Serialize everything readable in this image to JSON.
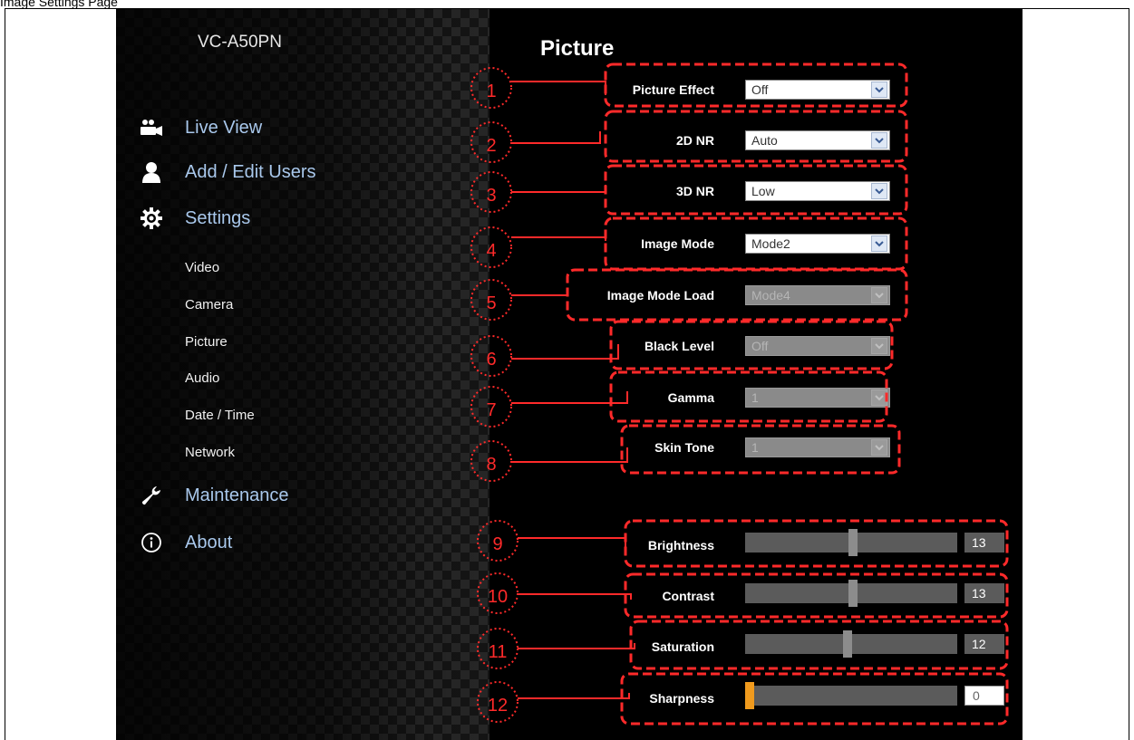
{
  "document_caption": "Image Settings Page",
  "device": {
    "name": "VC-A50PN"
  },
  "nav": {
    "items": [
      {
        "label": "Live View",
        "icon": "camera-users-icon"
      },
      {
        "label": "Add / Edit Users",
        "icon": "user-icon"
      },
      {
        "label": "Settings",
        "icon": "gear-icon"
      },
      {
        "label": "Maintenance",
        "icon": "wrench-icon"
      },
      {
        "label": "About",
        "icon": "info-icon"
      }
    ],
    "settings_subitems": [
      "Video",
      "Camera",
      "Picture",
      "Audio",
      "Date / Time",
      "Network"
    ]
  },
  "page": {
    "title": "Picture",
    "selects": [
      {
        "label": "Picture Effect",
        "value": "Off",
        "disabled": false
      },
      {
        "label": "2D NR",
        "value": "Auto",
        "disabled": false
      },
      {
        "label": "3D NR",
        "value": "Low",
        "disabled": false
      },
      {
        "label": "Image Mode",
        "value": "Mode2",
        "disabled": false
      },
      {
        "label": "Image Mode Load",
        "value": "Mode4",
        "disabled": true
      },
      {
        "label": "Black Level",
        "value": "Off",
        "disabled": true
      },
      {
        "label": "Gamma",
        "value": "1",
        "disabled": true
      },
      {
        "label": "Skin Tone",
        "value": "1",
        "disabled": true
      }
    ],
    "sliders": [
      {
        "label": "Brightness",
        "value": "13",
        "fraction": 0.51
      },
      {
        "label": "Contrast",
        "value": "13",
        "fraction": 0.51
      },
      {
        "label": "Saturation",
        "value": "12",
        "fraction": 0.48
      },
      {
        "label": "Sharpness",
        "value": "0",
        "fraction": 0.0
      }
    ]
  },
  "annotations": [
    "1",
    "2",
    "3",
    "4",
    "5",
    "6",
    "7",
    "8",
    "9",
    "10",
    "11",
    "12"
  ],
  "colors": {
    "annotation": "#ff2a2a",
    "link": "#a9c8ec",
    "sharpness_thumb": "#ef9a1d"
  }
}
